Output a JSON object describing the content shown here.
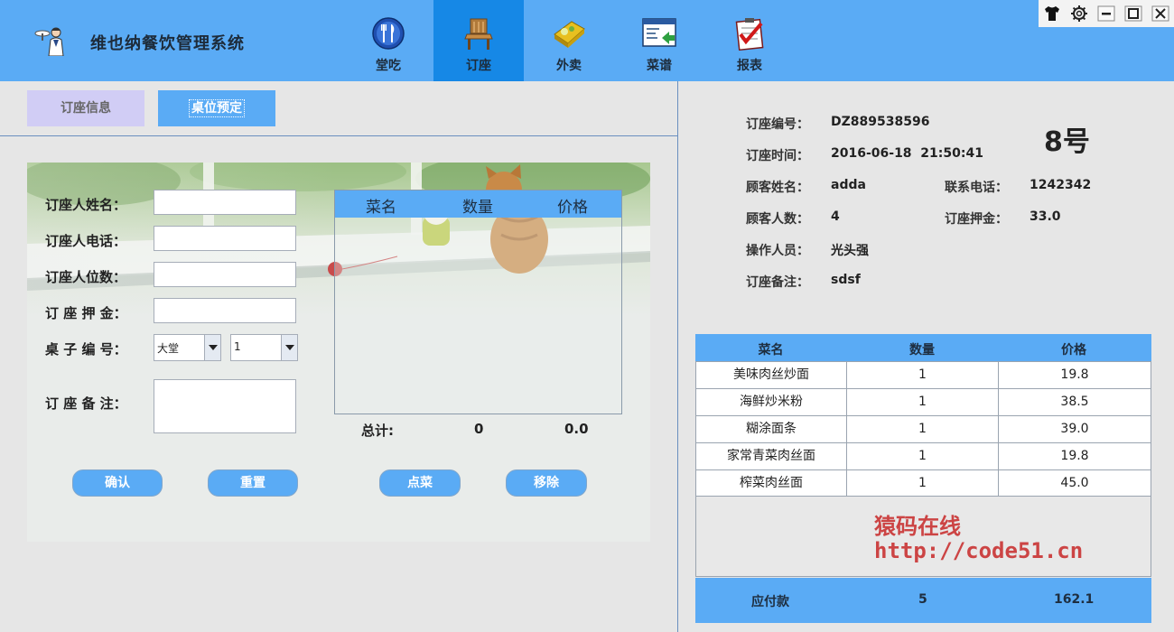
{
  "app": {
    "title": "维也纳餐饮管理系统",
    "logo_icon": "waiter-icon"
  },
  "nav": [
    {
      "label": "堂吃",
      "icon": "utensils-icon",
      "active": false
    },
    {
      "label": "订座",
      "icon": "chair-icon",
      "active": true
    },
    {
      "label": "外卖",
      "icon": "takeout-icon",
      "active": false
    },
    {
      "label": "菜谱",
      "icon": "menu-icon",
      "active": false
    },
    {
      "label": "报表",
      "icon": "report-icon",
      "active": false
    }
  ],
  "window_controls": [
    "shirt-icon",
    "gear-icon",
    "minimize-icon",
    "maximize-icon",
    "close-icon"
  ],
  "subtabs": {
    "info": "订座信息",
    "reserve": "桌位预定"
  },
  "form": {
    "name_label": "订座人姓名：",
    "phone_label": "订座人电话：",
    "count_label": "订座人位数：",
    "deposit_label": "订 座 押 金：",
    "table_label": "桌 子 编 号：",
    "remark_label": "订 座 备 注：",
    "area_value": "大堂",
    "table_value": "1",
    "name_value": "",
    "phone_value": "",
    "count_value": "",
    "deposit_value": ""
  },
  "dish_list": {
    "col_name": "菜名",
    "col_qty": "数量",
    "col_price": "价格"
  },
  "totals": {
    "label": "总计:",
    "count": "0",
    "price": "0.0"
  },
  "buttons": {
    "confirm": "确认",
    "reset": "重置",
    "order": "点菜",
    "remove": "移除"
  },
  "reservation": {
    "no_label": "订座编号：",
    "no": "DZ889538596",
    "time_label": "订座时间：",
    "time": "2016-06-18  21:50:41",
    "customer_label": "顾客姓名：",
    "customer": "adda",
    "phone_label": "联系电话：",
    "phone": "1242342",
    "people_label": "顾客人数：",
    "people": "4",
    "deposit_label": "订座押金：",
    "deposit": "33.0",
    "operator_label": "操作人员：",
    "operator": "光头强",
    "remark_label": "订座备注：",
    "remark": "sdsf",
    "table_no": "8号"
  },
  "order_table": {
    "headers": [
      "菜名",
      "数量",
      "价格"
    ],
    "rows": [
      [
        "美味肉丝炒面",
        "1",
        "19.8"
      ],
      [
        "海鲜炒米粉",
        "1",
        "38.5"
      ],
      [
        "糊涂面条",
        "1",
        "39.0"
      ],
      [
        "家常青菜肉丝面",
        "1",
        "19.8"
      ],
      [
        "榨菜肉丝面",
        "1",
        "45.0"
      ]
    ]
  },
  "watermark": {
    "line1": "猿码在线",
    "line2": "http://code51.cn"
  },
  "payment": {
    "label": "应付款",
    "count": "5",
    "amount": "162.1"
  }
}
